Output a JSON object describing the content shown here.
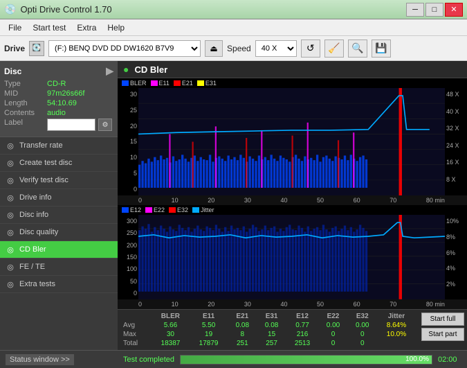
{
  "titleBar": {
    "title": "Opti Drive Control 1.70",
    "icon": "💿"
  },
  "menuBar": {
    "items": [
      "File",
      "Start test",
      "Extra",
      "Help"
    ]
  },
  "driveBar": {
    "label": "Drive",
    "driveValue": "(F:)  BENQ DVD DD DW1620 B7V9",
    "speedLabel": "Speed",
    "speedValue": "40 X"
  },
  "disc": {
    "title": "Disc",
    "type": {
      "label": "Type",
      "value": "CD-R"
    },
    "mid": {
      "label": "MID",
      "value": "97m26s66f"
    },
    "length": {
      "label": "Length",
      "value": "54:10.69"
    },
    "contents": {
      "label": "Contents",
      "value": "audio"
    },
    "label": {
      "label": "Label",
      "value": ""
    }
  },
  "sidebar": {
    "items": [
      {
        "id": "transfer-rate",
        "label": "Transfer rate",
        "icon": "◎"
      },
      {
        "id": "create-test-disc",
        "label": "Create test disc",
        "icon": "◎"
      },
      {
        "id": "verify-test-disc",
        "label": "Verify test disc",
        "icon": "◎"
      },
      {
        "id": "drive-info",
        "label": "Drive info",
        "icon": "◎"
      },
      {
        "id": "disc-info",
        "label": "Disc info",
        "icon": "◎"
      },
      {
        "id": "disc-quality",
        "label": "Disc quality",
        "icon": "◎"
      },
      {
        "id": "cd-bler",
        "label": "CD Bler",
        "icon": "◎",
        "active": true
      },
      {
        "id": "fe-te",
        "label": "FE / TE",
        "icon": "◎"
      },
      {
        "id": "extra-tests",
        "label": "Extra tests",
        "icon": "◎"
      }
    ]
  },
  "chart": {
    "title": "CD Bler",
    "topLegend": [
      {
        "label": "BLER",
        "color": "#0044ff"
      },
      {
        "label": "E11",
        "color": "#ff00ff"
      },
      {
        "label": "E21",
        "color": "#ff0000"
      },
      {
        "label": "E31",
        "color": "#ffff00"
      }
    ],
    "bottomLegend": [
      {
        "label": "E12",
        "color": "#0044ff"
      },
      {
        "label": "E22",
        "color": "#ff00ff"
      },
      {
        "label": "E32",
        "color": "#ff0000"
      },
      {
        "label": "Jitter",
        "color": "#00aaff"
      }
    ],
    "topYAxis": [
      "30",
      "25",
      "20",
      "15",
      "10",
      "5",
      "0"
    ],
    "topYAxisRight": [
      "48 X",
      "40 X",
      "32 X",
      "24 X",
      "16 X",
      "8 X",
      ""
    ],
    "bottomYAxis": [
      "300",
      "250",
      "200",
      "150",
      "100",
      "50",
      "0"
    ],
    "bottomYAxisRight": [
      "10%",
      "8%",
      "6%",
      "4%",
      "2%",
      ""
    ],
    "xAxisLabels": [
      "0",
      "10",
      "20",
      "30",
      "40",
      "50",
      "60",
      "70",
      "80 min"
    ]
  },
  "stats": {
    "headers": [
      "BLER",
      "E11",
      "E21",
      "E31",
      "E12",
      "E22",
      "E32",
      "Jitter"
    ],
    "rows": [
      {
        "label": "Avg",
        "values": [
          "5.66",
          "5.50",
          "0.08",
          "0.08",
          "0.77",
          "0.00",
          "0.00",
          "8.64%"
        ]
      },
      {
        "label": "Max",
        "values": [
          "30",
          "19",
          "8",
          "15",
          "216",
          "0",
          "0",
          "10.0%"
        ]
      },
      {
        "label": "Total",
        "values": [
          "18387",
          "17879",
          "251",
          "257",
          "2513",
          "0",
          "0",
          ""
        ]
      }
    ]
  },
  "actions": {
    "startFull": "Start full",
    "startPart": "Start part"
  },
  "statusBar": {
    "windowLabel": "Status window >>",
    "statusText": "Test completed",
    "progressValue": "100.0%",
    "timeValue": "02:00"
  }
}
